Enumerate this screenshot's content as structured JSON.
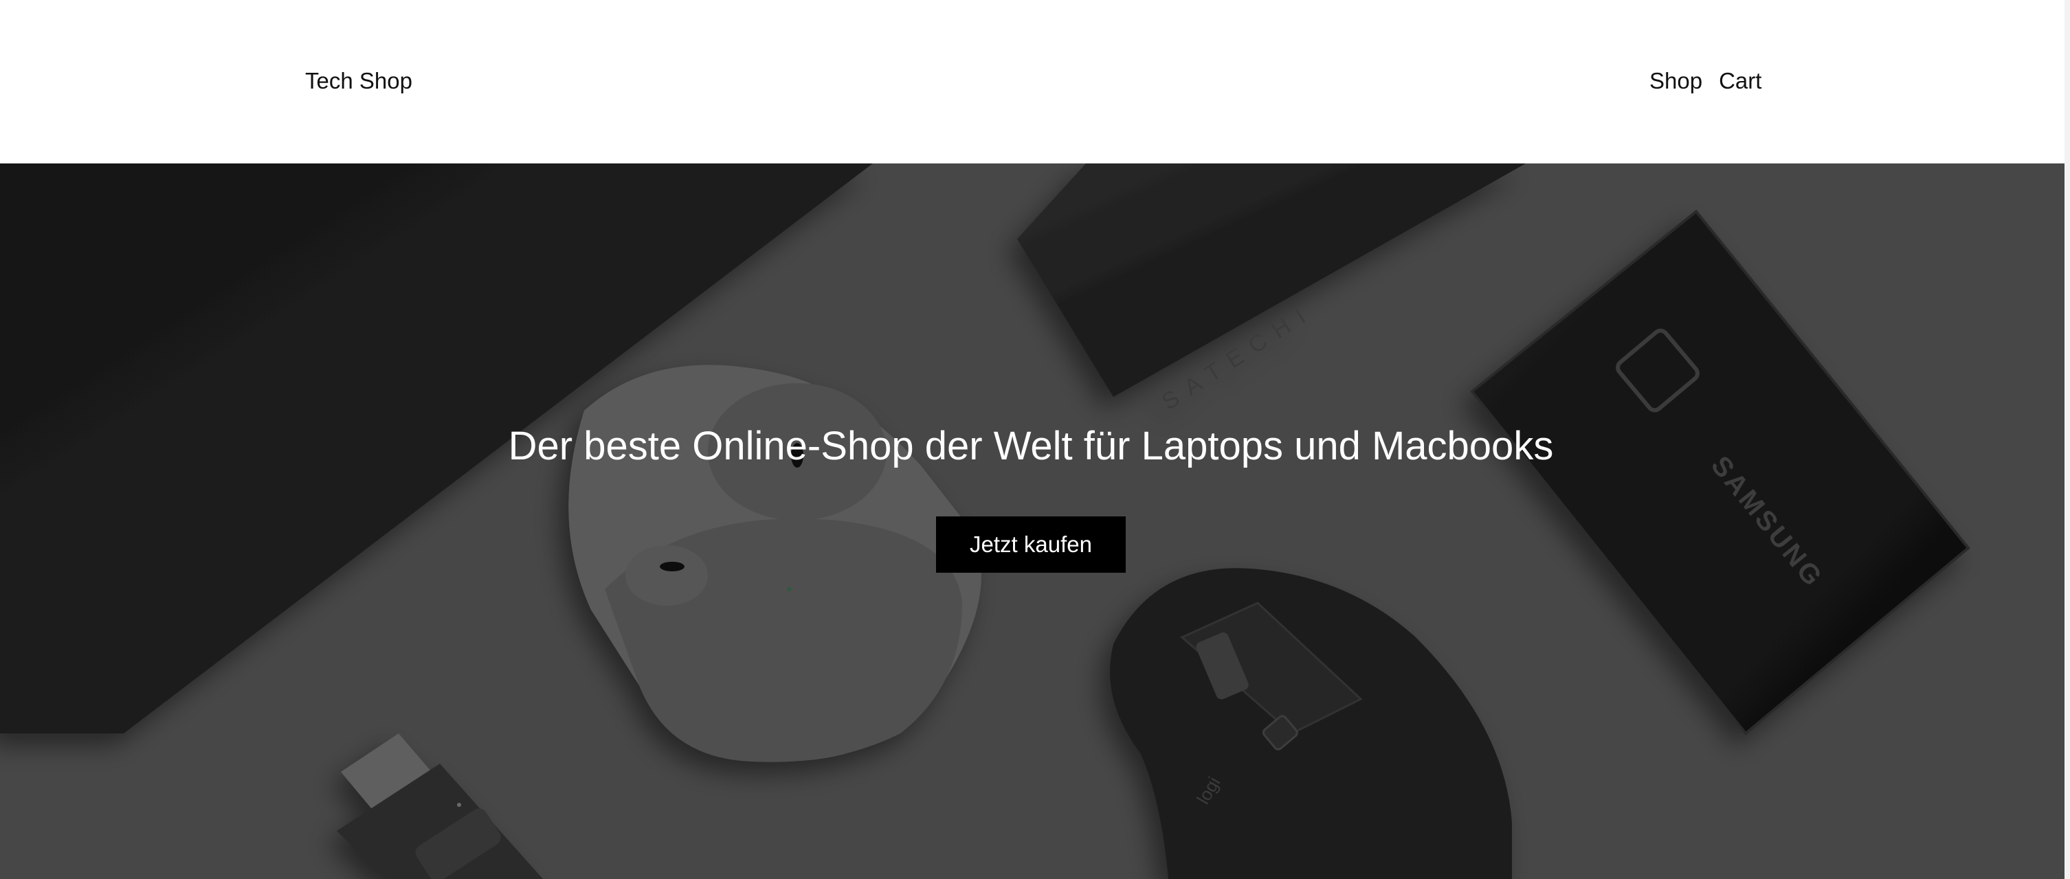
{
  "header": {
    "brand": "Tech Shop",
    "nav": [
      {
        "label": "Shop"
      },
      {
        "label": "Cart"
      }
    ]
  },
  "hero": {
    "title": "Der beste Online-Shop der Welt für Laptops und Macbooks",
    "cta_label": "Jetzt kaufen",
    "background": {
      "description_icons": [
        "laptop",
        "usb-hub",
        "ssd",
        "earbuds-case",
        "mouse",
        "usb-adapter"
      ],
      "overlay_color": "#474747"
    },
    "product_branding": {
      "hub_logo": "SATECHI",
      "ssd_logo": "SAMSUNG",
      "mouse_logo": "logi"
    }
  }
}
